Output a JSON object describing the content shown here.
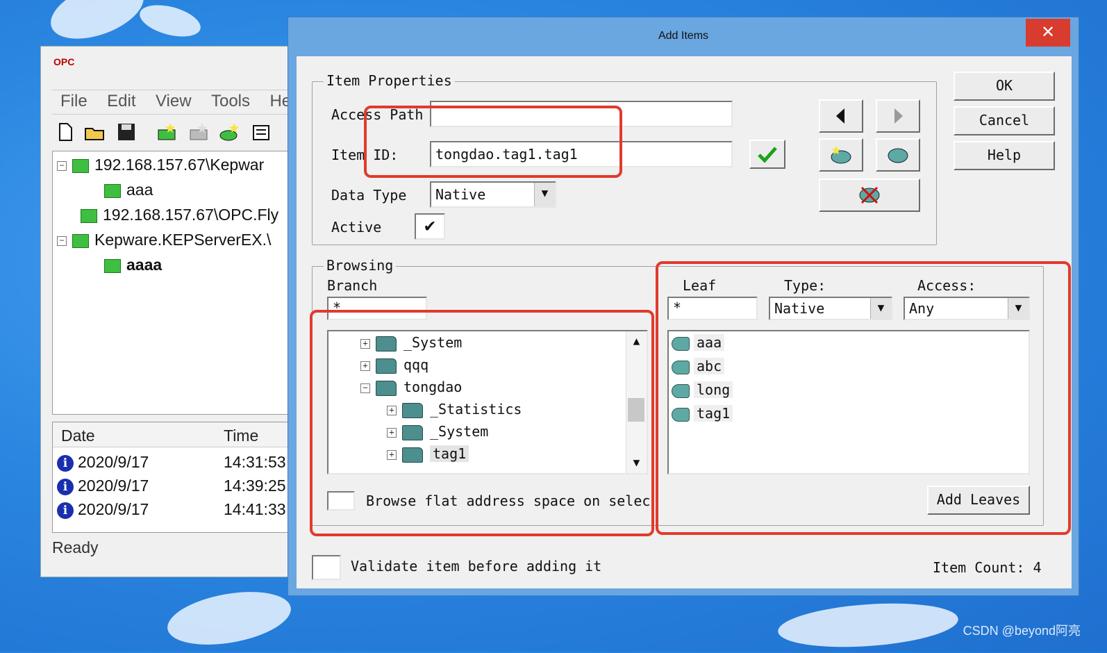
{
  "background_window": {
    "logo": "OPC",
    "menu": [
      "File",
      "Edit",
      "View",
      "Tools",
      "He"
    ],
    "tree": [
      {
        "label": "192.168.157.67\\Kepwar",
        "level": 0,
        "expander": "−"
      },
      {
        "label": "aaa",
        "level": 1,
        "expander": ""
      },
      {
        "label": "192.168.157.67\\OPC.Fly",
        "level": 0,
        "expander": ""
      },
      {
        "label": "Kepware.KEPServerEX.\\",
        "level": 0,
        "expander": "−"
      },
      {
        "label": "aaaa",
        "level": 1,
        "expander": ""
      }
    ],
    "log_headers": {
      "date": "Date",
      "time": "Time"
    },
    "log_rows": [
      {
        "date": "2020/9/17",
        "time": "14:31:53"
      },
      {
        "date": "2020/9/17",
        "time": "14:39:25"
      },
      {
        "date": "2020/9/17",
        "time": "14:41:33"
      }
    ],
    "status": "Ready"
  },
  "dialog": {
    "title": "Add Items",
    "close_glyph": "✕",
    "item_properties": {
      "legend": "Item Properties",
      "access_path_label": "Access Path",
      "access_path_value": "",
      "item_id_label": "Item ID:",
      "item_id_value": "tongdao.tag1.tag1",
      "data_type_label": "Data Type",
      "data_type_value": "Native",
      "active_label": "Active",
      "active_checked": "✔"
    },
    "buttons": {
      "ok": "OK",
      "cancel": "Cancel",
      "help": "Help",
      "add_leaves": "Add Leaves"
    },
    "browsing": {
      "legend": "Browsing",
      "branch_label": "Branch",
      "branch_filter": "*",
      "tree": [
        {
          "label": "_System",
          "level": 1,
          "expander": "+"
        },
        {
          "label": "qqq",
          "level": 1,
          "expander": "+"
        },
        {
          "label": "tongdao",
          "level": 1,
          "expander": "−"
        },
        {
          "label": "_Statistics",
          "level": 2,
          "expander": "+"
        },
        {
          "label": "_System",
          "level": 2,
          "expander": "+"
        },
        {
          "label": "tag1",
          "level": 2,
          "expander": "+"
        }
      ],
      "flat_label": "Browse flat address space on select",
      "leaf_label": "Leaf",
      "leaf_filter": "*",
      "type_label": "Type:",
      "type_value": "Native",
      "access_label": "Access:",
      "access_value": "Any",
      "leaves": [
        "aaa",
        "abc",
        "long",
        "tag1"
      ]
    },
    "validate_label": "Validate item before adding it",
    "item_count_label": "Item Count:",
    "item_count_value": "4"
  },
  "watermark": "CSDN @beyond阿亮",
  "colors": {
    "highlight_red": "#e03b2c",
    "title_blue": "#6aa6e0",
    "dialog_bg": "#f0f0f0",
    "close_red": "#d83c2e"
  }
}
